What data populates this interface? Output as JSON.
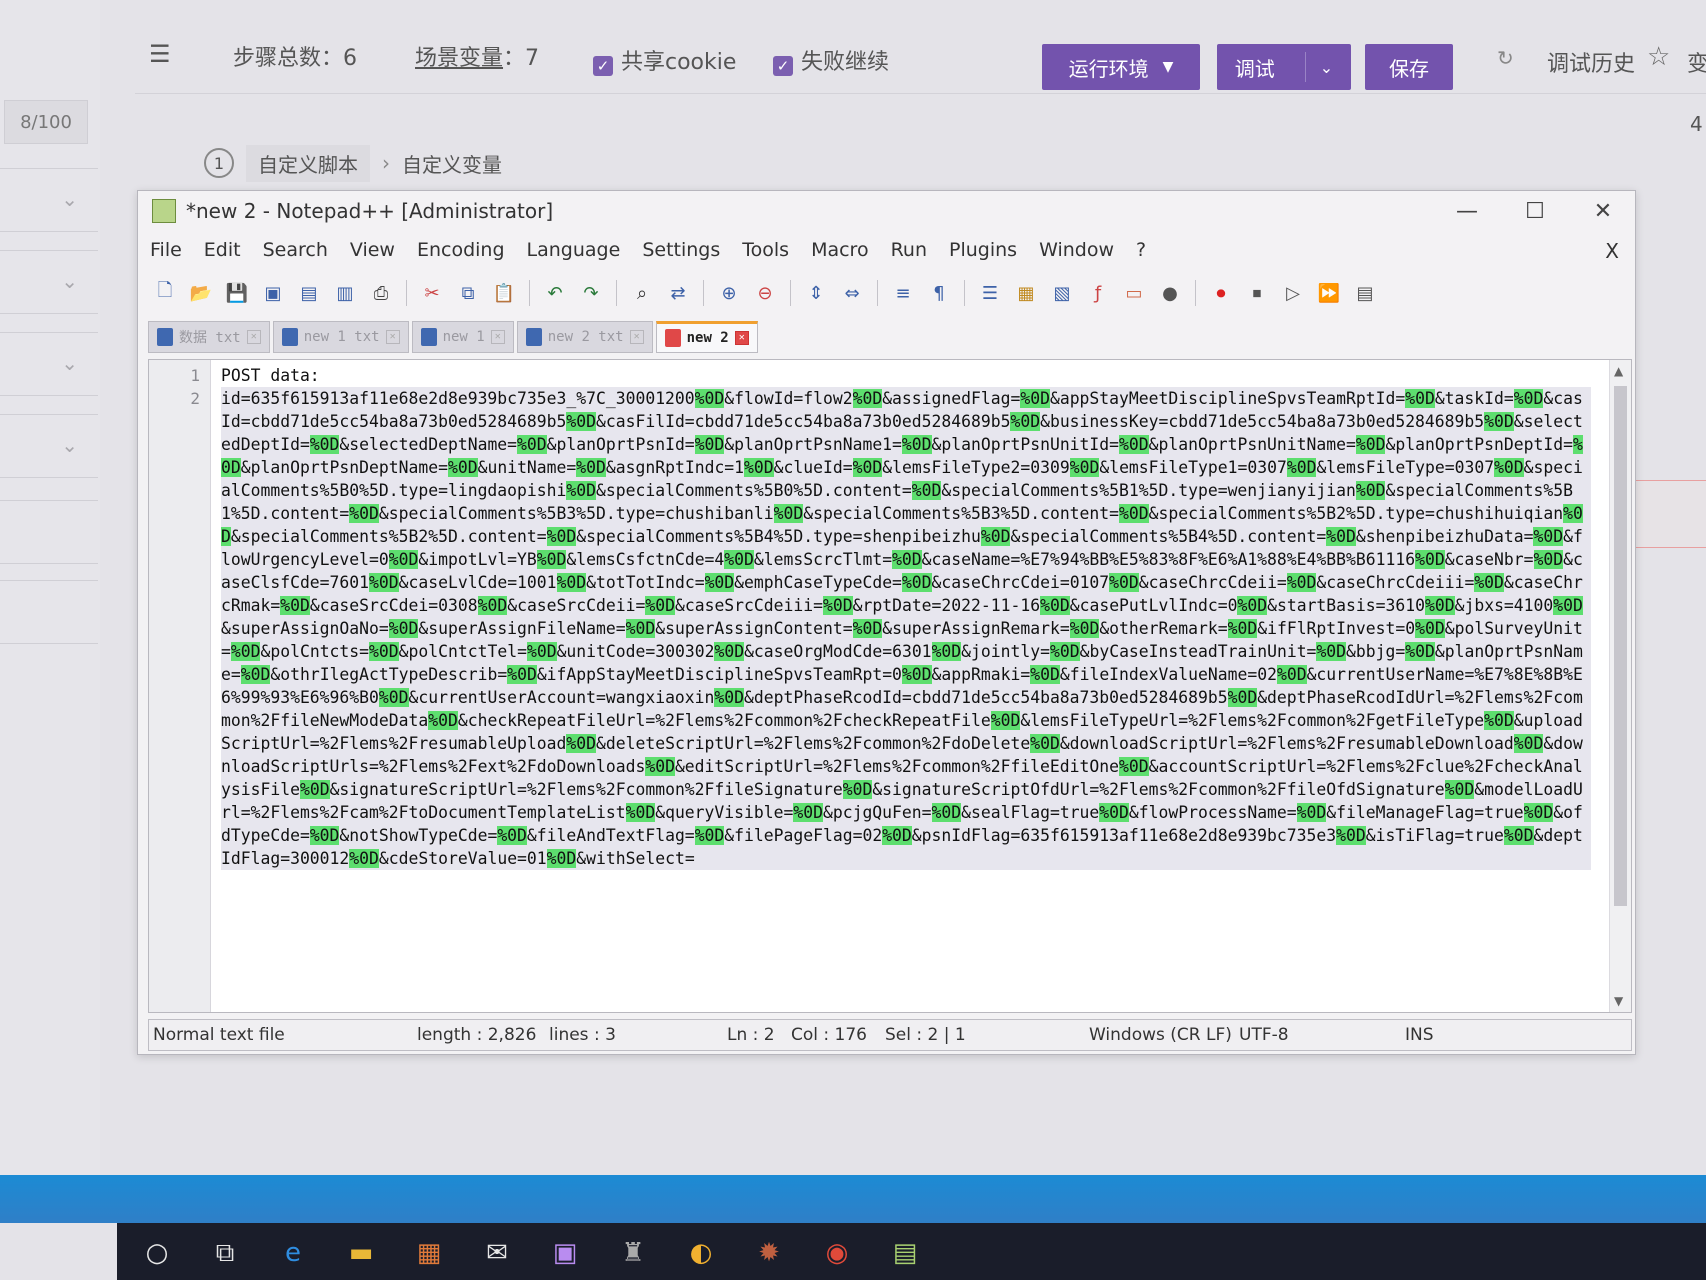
{
  "app": {
    "step_total_label": "步骤总数：6",
    "scene_vars_label": "场景变量",
    "scene_vars_count": "：7",
    "share_cookie_label": "共享cookie",
    "fail_continue_label": "失败继续",
    "run_env_button": "运行环境",
    "debug_button": "调试",
    "save_button": "保存",
    "debug_history_label": "调试历史",
    "right_edge_text": "变",
    "right_edge_number": "4"
  },
  "sidebar": {
    "counter": "8/100"
  },
  "breadcrumb": {
    "step_number": "1",
    "tab_label": "自定义脚本",
    "next_label": "自定义变量"
  },
  "npp": {
    "title": "*new 2 - Notepad++ [Administrator]",
    "menu": [
      "File",
      "Edit",
      "Search",
      "View",
      "Encoding",
      "Language",
      "Settings",
      "Tools",
      "Macro",
      "Run",
      "Plugins",
      "Window",
      "?"
    ],
    "menu_close": "X",
    "tabs": [
      {
        "label": "数据 txt",
        "active": false
      },
      {
        "label": "new 1 txt",
        "active": false
      },
      {
        "label": "new 1",
        "active": false
      },
      {
        "label": "new 2 txt",
        "active": false
      },
      {
        "label": "new 2",
        "active": true
      }
    ],
    "line_numbers": [
      "1",
      "2"
    ],
    "line1": "POST data:",
    "line2_segments": [
      "id=635f615913af11e68e2d8e939bc735e3_%7C_30001200",
      "%0D",
      "&flowId=flow2",
      "%0D",
      "&assignedFlag=",
      "%0D",
      "&appStayMeetDisciplineSpvsTeamRptId=",
      "%0D",
      "&taskId=",
      "%0D",
      "&casId=cbdd71de5cc54ba8a73b0ed5284689b5",
      "%0D",
      "&casFilId=cbdd71de5cc54ba8a73b0ed5284689b5",
      "%0D",
      "&businessKey=cbdd71de5cc54ba8a73b0ed5284689b5",
      "%0D",
      "&selectedDeptId=",
      "%0D",
      "&selectedDeptName=",
      "%0D",
      "&planOprtPsnId=",
      "%0D",
      "&planOprtPsnName1=",
      "%0D",
      "&planOprtPsnUnitId=",
      "%0D",
      "&planOprtPsnUnitName=",
      "%0D",
      "&planOprtPsnDeptId=",
      "%0D",
      "&planOprtPsnDeptName=",
      "%0D",
      "&unitName=",
      "%0D",
      "&asgnRptIndc=1",
      "%0D",
      "&clueId=",
      "%0D",
      "&lemsFileType2=0309",
      "%0D",
      "&lemsFileType1=0307",
      "%0D",
      "&lemsFileType=0307",
      "%0D",
      "&specialComments%5B0%5D.type=lingdaopishi",
      "%0D",
      "&specialComments%5B0%5D.content=",
      "%0D",
      "&specialComments%5B1%5D.type=wenjianyijian",
      "%0D",
      "&specialComments%5B1%5D.content=",
      "%0D",
      "&specialComments%5B3%5D.type=chushibanli",
      "%0D",
      "&specialComments%5B3%5D.content=",
      "%0D",
      "&specialComments%5B2%5D.type=chushihuiqian",
      "%0D",
      "&specialComments%5B2%5D.content=",
      "%0D",
      "&specialComments%5B4%5D.type=shenpibeizhu",
      "%0D",
      "&specialComments%5B4%5D.content=",
      "%0D",
      "&shenpibeizhuData=",
      "%0D",
      "&flowUrgencyLevel=0",
      "%0D",
      "&impotLvl=YB",
      "%0D",
      "&lemsCsfctnCde=4",
      "%0D",
      "&lemsScrcTlmt=",
      "%0D",
      "&caseName=%E7%94%BB%E5%83%8F%E6%A1%88%E4%BB%B61116",
      "%0D",
      "&caseNbr=",
      "%0D",
      "&caseClsfCde=7601",
      "%0D",
      "&caseLvlCde=1001",
      "%0D",
      "&totTotIndc=",
      "%0D",
      "&emphCaseTypeCde=",
      "%0D",
      "&caseChrcCdei=0107",
      "%0D",
      "&caseChrcCdeii=",
      "%0D",
      "&caseChrcCdeiii=",
      "%0D",
      "&caseChrcRmak=",
      "%0D",
      "&caseSrcCdei=0308",
      "%0D",
      "&caseSrcCdeii=",
      "%0D",
      "&caseSrcCdeiii=",
      "%0D",
      "&rptDate=2022-11-16",
      "%0D",
      "&casePutLvlIndc=0",
      "%0D",
      "&startBasis=3610",
      "%0D",
      "&jbxs=4100",
      "%0D",
      "&superAssignOaNo=",
      "%0D",
      "&superAssignFileName=",
      "%0D",
      "&superAssignContent=",
      "%0D",
      "&superAssignRemark=",
      "%0D",
      "&otherRemark=",
      "%0D",
      "&ifFlRptInvest=0",
      "%0D",
      "&polSurveyUnit=",
      "%0D",
      "&polCntcts=",
      "%0D",
      "&polCntctTel=",
      "%0D",
      "&unitCode=300302",
      "%0D",
      "&caseOrgModCde=6301",
      "%0D",
      "&jointly=",
      "%0D",
      "&byCaseInsteadTrainUnit=",
      "%0D",
      "&bbjg=",
      "%0D",
      "&planOprtPsnName=",
      "%0D",
      "&othrIlegActTypeDescrib=",
      "%0D",
      "&ifAppStayMeetDisciplineSpvsTeamRpt=0",
      "%0D",
      "&appRmaki=",
      "%0D",
      "&fileIndexValueName=02",
      "%0D",
      "&currentUserName=%E7%8E%8B%E6%99%93%E6%96%B0",
      "%0D",
      "&currentUserAccount=wangxiaoxin",
      "%0D",
      "&deptPhaseRcodId=cbdd71de5cc54ba8a73b0ed5284689b5",
      "%0D",
      "&deptPhaseRcodIdUrl=%2Flems%2Fcommon%2FfileNewModeData",
      "%0D",
      "&checkRepeatFileUrl=%2Flems%2Fcommon%2FcheckRepeatFile",
      "%0D",
      "&lemsFileTypeUrl=%2Flems%2Fcommon%2FgetFileType",
      "%0D",
      "&uploadScriptUrl=%2Flems%2FresumableUpload",
      "%0D",
      "&deleteScriptUrl=%2Flems%2Fcommon%2FdoDelete",
      "%0D",
      "&downloadScriptUrl=%2Flems%2FresumableDownload",
      "%0D",
      "&downloadScriptUrls=%2Flems%2Fext%2FdoDownloads",
      "%0D",
      "&editScriptUrl=%2Flems%2Fcommon%2FfileEditOne",
      "%0D",
      "&accountScriptUrl=%2Flems%2Fclue%2FcheckAnalysisFile",
      "%0D",
      "&signatureScriptUrl=%2Flems%2Fcommon%2FfileSignature",
      "%0D",
      "&signatureScriptOfdUrl=%2Flems%2Fcommon%2FfileOfdSignature",
      "%0D",
      "&modelLoadUrl=%2Flems%2Fcam%2FtoDocumentTemplateList",
      "%0D",
      "&queryVisible=",
      "%0D",
      "&pcjgQuFen=",
      "%0D",
      "&sealFlag=true",
      "%0D",
      "&flowProcessName=",
      "%0D",
      "&fileManageFlag=true",
      "%0D",
      "&ofdTypeCde=",
      "%0D",
      "&notShowTypeCde=",
      "%0D",
      "&fileAndTextFlag=",
      "%0D",
      "&filePageFlag=02",
      "%0D",
      "&psnIdFlag=635f615913af11e68e2d8e939bc735e3",
      "%0D",
      "&isTiFlag=true",
      "%0D",
      "&deptIdFlag=300012",
      "%0D",
      "&cdeStoreValue=01",
      "%0D",
      "&withSelect="
    ],
    "status": {
      "file_type": "Normal text file",
      "length": "length : 2,826",
      "lines": "lines : 3",
      "ln": "Ln : 2",
      "col": "Col : 176",
      "sel": "Sel : 2 | 1",
      "eol": "Windows (CR LF)",
      "encoding": "UTF-8",
      "mode": "INS"
    }
  },
  "taskbar": {
    "icons": [
      "cortana-icon",
      "task-view-icon",
      "edge-icon",
      "file-explorer-icon",
      "store-icon",
      "mail-icon",
      "app-icon",
      "app-icon-2",
      "app-icon-3",
      "app-icon-4",
      "chrome-icon",
      "notepadpp-icon"
    ]
  }
}
